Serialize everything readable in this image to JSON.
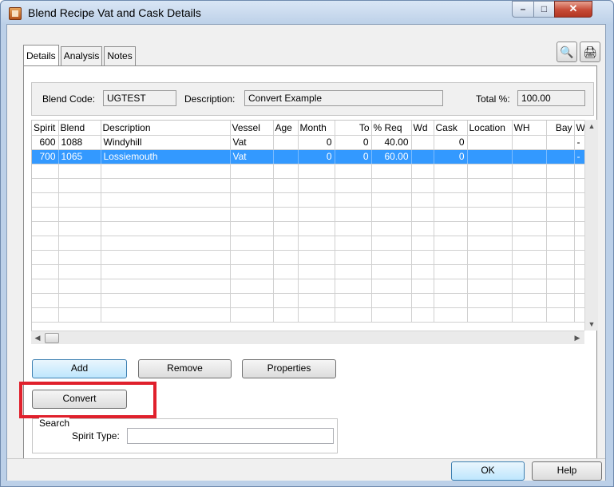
{
  "window": {
    "title": "Blend Recipe Vat and Cask Details",
    "min_glyph": "–",
    "max_glyph": "□",
    "close_glyph": "✕"
  },
  "tabs": [
    {
      "label": "Details",
      "active": true
    },
    {
      "label": "Analysis",
      "active": false
    },
    {
      "label": "Notes",
      "active": false
    }
  ],
  "toolbar": {
    "find_glyph": "🔍",
    "print_glyph": "🖨"
  },
  "header": {
    "blend_code_label": "Blend Code:",
    "blend_code_value": "UGTEST",
    "description_label": "Description:",
    "description_value": "Convert Example",
    "total_label": "Total %:",
    "total_value": "100.00"
  },
  "grid": {
    "columns": [
      "Spirit",
      "Blend",
      "Description",
      "Vessel",
      "Age",
      "Month",
      "To",
      "% Req",
      "Wd",
      "Cask",
      "Location",
      "WH",
      "Bay",
      "W"
    ],
    "rows": [
      {
        "spirit": "600",
        "blend": "1088",
        "description": "Windyhill",
        "vessel": "Vat",
        "age": "",
        "month": "0",
        "to": "0",
        "req": "40.00",
        "wd": "",
        "cask": "0",
        "location": "",
        "wh": "",
        "bay": "",
        "w": "-"
      },
      {
        "spirit": "700",
        "blend": "1065",
        "description": "Lossiemouth",
        "vessel": "Vat",
        "age": "",
        "month": "0",
        "to": "0",
        "req": "60.00",
        "wd": "",
        "cask": "0",
        "location": "",
        "wh": "",
        "bay": "",
        "w": "-"
      }
    ],
    "selected_row": 1
  },
  "buttons": {
    "add": "Add",
    "remove": "Remove",
    "properties": "Properties",
    "convert": "Convert",
    "ok": "OK",
    "help": "Help"
  },
  "search": {
    "group_label": "Search",
    "spirit_type_label": "Spirit Type:",
    "spirit_type_value": ""
  },
  "colors": {
    "selection": "#3399ff",
    "highlight": "#e0202c"
  }
}
